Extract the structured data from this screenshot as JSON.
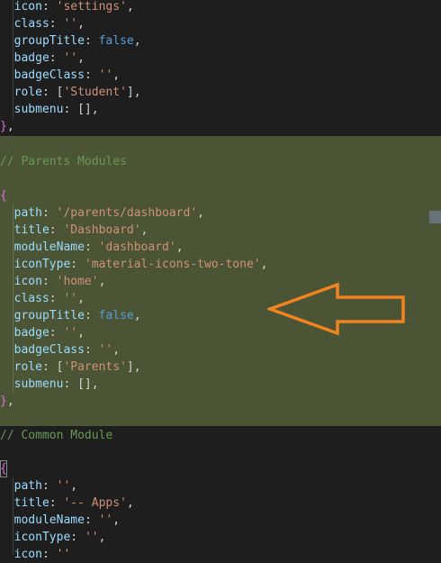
{
  "code": {
    "top_block": {
      "icon": "'settings'",
      "class": "''",
      "groupTitle": "false",
      "badge": "''",
      "badgeClass": "''",
      "role": "'Student'",
      "submenu": "[]"
    },
    "parents_comment": "// Parents Modules",
    "parents_block": {
      "path": "'/parents/dashboard'",
      "title": "'Dashboard'",
      "moduleName": "'dashboard'",
      "iconType": "'material-icons-two-tone'",
      "icon": "'home'",
      "class": "''",
      "groupTitle": "false",
      "badge": "''",
      "badgeClass": "''",
      "role": "'Parents'",
      "submenu": "[]"
    },
    "common_comment": "// Common Module",
    "common_block": {
      "path": "''",
      "title": "'-- Apps'",
      "moduleName": "''",
      "iconType": "''",
      "icon": "''"
    }
  },
  "colors": {
    "background": "#1e1e1e",
    "highlight": "#4b5535",
    "arrow": "#f2841f",
    "key": "#9cdcfe",
    "string": "#ce9178",
    "boolean": "#569cd6",
    "comment": "#6a9955",
    "bracket": "#da70d6"
  },
  "annotation": {
    "icon": "left-arrow-icon"
  }
}
